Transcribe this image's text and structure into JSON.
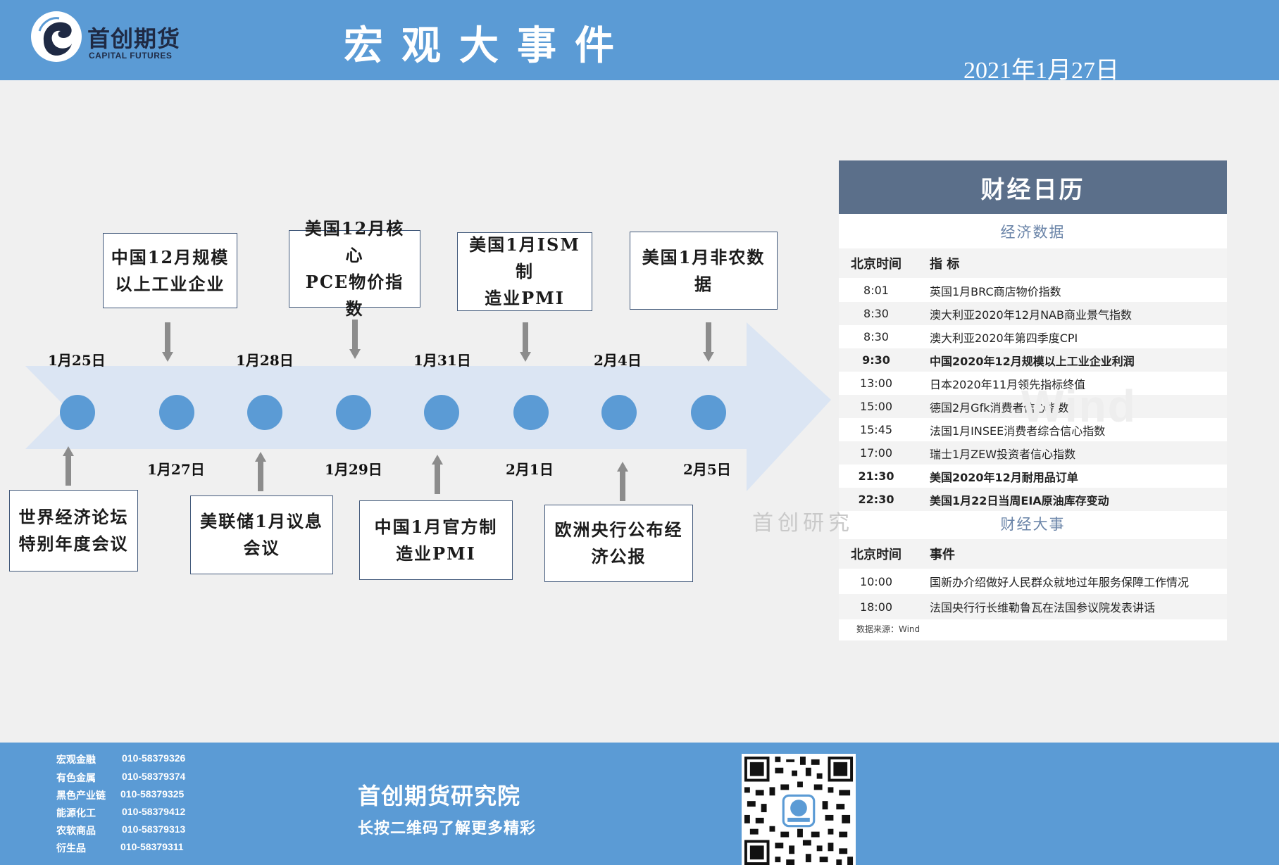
{
  "header": {
    "logo_cn": "首创期货",
    "logo_en": "CAPITAL FUTURES",
    "title": "宏观大事件",
    "date": "2021年1月27日"
  },
  "timeline": {
    "dates_top": [
      "1月25日",
      "1月28日",
      "1月31日",
      "2月4日"
    ],
    "dates_bottom": [
      "1月27日",
      "1月29日",
      "2月1日",
      "2月5日"
    ],
    "events_top": [
      [
        "中国12月规模",
        "以上工业企业"
      ],
      [
        "美国12月核心",
        "PCE物价指数"
      ],
      [
        "美国1月ISM制",
        "造业PMI"
      ],
      [
        "美国1月非农数",
        "据"
      ]
    ],
    "events_bottom": [
      [
        "世界经济论坛",
        "特别年度会议"
      ],
      [
        "美联储1月议息",
        "会议"
      ],
      [
        "中国1月官方制",
        "造业PMI"
      ],
      [
        "欧洲央行公布经",
        "济公报"
      ]
    ],
    "watermark": "首创研究"
  },
  "calendar": {
    "title": "财经日历",
    "watermark": "Wind",
    "econ_title": "经济数据",
    "col_time": "北京时间",
    "col_indicator": "指 标",
    "econ_rows": [
      {
        "time": "8:01",
        "desc": "英国1月BRC商店物价指数"
      },
      {
        "time": "8:30",
        "desc": "澳大利亚2020年12月NAB商业景气指数"
      },
      {
        "time": "8:30",
        "desc": "澳大利亚2020年第四季度CPI"
      },
      {
        "time": "9:30",
        "desc": "中国2020年12月规模以上工业企业利润"
      },
      {
        "time": "13:00",
        "desc": "日本2020年11月领先指标终值"
      },
      {
        "time": "15:00",
        "desc": "德国2月Gfk消费者信心指数"
      },
      {
        "time": "15:45",
        "desc": "法国1月INSEE消费者综合信心指数"
      },
      {
        "time": "17:00",
        "desc": "瑞士1月ZEW投资者信心指数"
      },
      {
        "time": "21:30",
        "desc": "美国2020年12月耐用品订单"
      },
      {
        "time": "22:30",
        "desc": "美国1月22日当周EIA原油库存变动"
      }
    ],
    "events_title": "财经大事",
    "col_event": "事件",
    "event_rows": [
      {
        "time": "10:00",
        "desc": "国新办介绍做好人民群众就地过年服务保障工作情况"
      },
      {
        "time": "18:00",
        "desc": "法国央行行长维勒鲁瓦在法国参议院发表讲话"
      }
    ],
    "source": "数据来源：Wind"
  },
  "footer": {
    "contacts": [
      {
        "name": "宏观金融",
        "phone": "010-58379326"
      },
      {
        "name": "有色金属",
        "phone": "010-58379374"
      },
      {
        "name": "黑色产业链",
        "phone": "010-58379325"
      },
      {
        "name": "能源化工",
        "phone": "010-58379412"
      },
      {
        "name": "农软商品",
        "phone": "010-58379313"
      },
      {
        "name": "衍生品",
        "phone": "010-58379311"
      }
    ],
    "institute": "首创期货研究院",
    "tagline": "长按二维码了解更多精彩"
  },
  "colors": {
    "brand_blue": "#5b9bd5",
    "panel_header": "#5b6f8a",
    "arrow_fill": "#dbe5f3",
    "section_title": "#6a84a8"
  }
}
